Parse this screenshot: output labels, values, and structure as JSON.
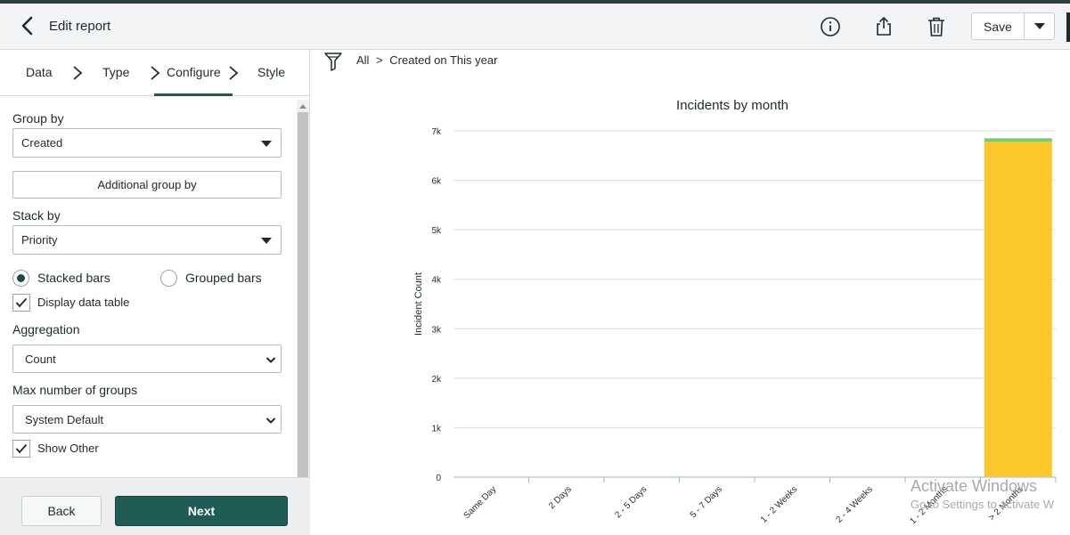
{
  "header": {
    "title": "Edit report",
    "save_label": "Save"
  },
  "steps": {
    "data": "Data",
    "type": "Type",
    "configure": "Configure",
    "style": "Style"
  },
  "form": {
    "group_by_label": "Group by",
    "group_by_value": "Created",
    "additional_group_by": "Additional group by",
    "stack_by_label": "Stack by",
    "stack_by_value": "Priority",
    "stacked_bars": "Stacked bars",
    "grouped_bars": "Grouped bars",
    "display_data_table": "Display data table",
    "aggregation_label": "Aggregation",
    "aggregation_value": "Count",
    "max_groups_label": "Max number of groups",
    "max_groups_value": "System Default",
    "show_other": "Show Other"
  },
  "footer": {
    "back": "Back",
    "next": "Next"
  },
  "breadcrumb": {
    "all": "All",
    "separator": ">",
    "condition": "Created on This year"
  },
  "chart_data": {
    "type": "bar",
    "title": "Incidents by month",
    "ylabel": "Incident Count",
    "xlabel": "",
    "ylim": [
      0,
      7000
    ],
    "yticks": [
      0,
      1000,
      2000,
      3000,
      4000,
      5000,
      6000,
      7000
    ],
    "ytick_labels": [
      "0",
      "1k",
      "2k",
      "3k",
      "4k",
      "5k",
      "6k",
      "7k"
    ],
    "categories": [
      "Same Day",
      "2 Days",
      "2 - 5 Days",
      "5 - 7 Days",
      "1 - 2 Weeks",
      "2 - 4 Weeks",
      "1 - 2 Months",
      "> 2 Months"
    ],
    "series": [
      {
        "values": [
          0,
          0,
          0,
          0,
          0,
          0,
          0,
          6780
        ],
        "color": "#fcc72a"
      },
      {
        "values": [
          0,
          0,
          0,
          0,
          0,
          0,
          0,
          70
        ],
        "color": "#79cc6e"
      }
    ],
    "grid": true
  },
  "watermark": {
    "line1": "Activate Windows",
    "line2": "Go to Settings to activate W"
  },
  "colors": {
    "primary": "#1e5c55",
    "bar_main": "#fcc72a",
    "bar_top": "#79cc6e"
  }
}
